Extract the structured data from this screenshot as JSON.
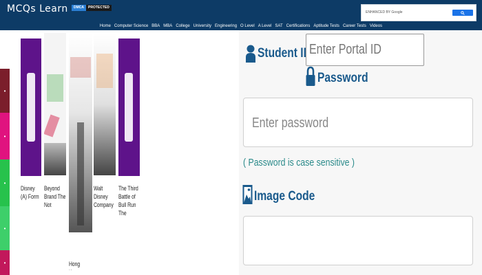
{
  "header": {
    "logo": "MCQs Learn",
    "badge_left": "DMCA",
    "badge_right": "PROTECTED",
    "search_label": "ENHANCED BY Google"
  },
  "nav": [
    "Home",
    "Computer Science",
    "BBA",
    "MBA",
    "College",
    "University",
    "Engineering",
    "O Level",
    "A Level",
    "SAT",
    "Certifications",
    "Aptitude Tests",
    "Career Tests",
    "Videos"
  ],
  "books": [
    {
      "title": "Disney (A) Form"
    },
    {
      "title": "Beyond Brand The Not"
    },
    {
      "title": "Hong Kong"
    },
    {
      "title": "Walt Disney Company"
    },
    {
      "title": "The Third Battle of Bull Run The"
    }
  ],
  "login": {
    "student_id_label": "Student ID",
    "student_id_placeholder": "Enter Portal ID",
    "password_label": "Password",
    "password_placeholder": "Enter password",
    "case_note": "( Password is case sensitive )",
    "image_code_label": "Image Code"
  },
  "colors": {
    "header": "#0d3b66",
    "label": "#1a5a8c",
    "note": "#2a8a8a",
    "search_button": "#1a73e8"
  }
}
